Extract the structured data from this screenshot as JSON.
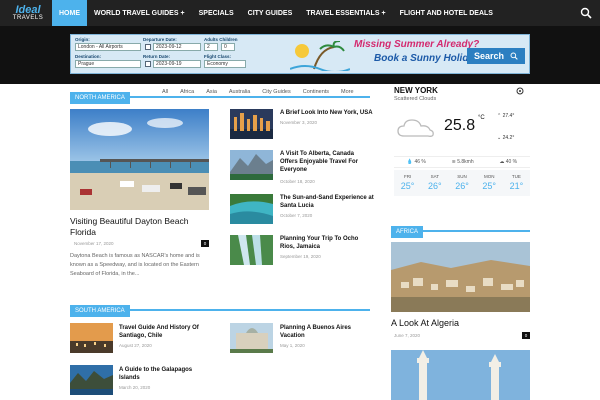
{
  "logo": {
    "line1": "Ideal",
    "line2": "TRAVELS"
  },
  "nav": {
    "items": [
      {
        "label": "HOME",
        "plus": ""
      },
      {
        "label": "WORLD TRAVEL GUIDES",
        "plus": "+"
      },
      {
        "label": "SPECIALS",
        "plus": ""
      },
      {
        "label": "CITY GUIDES",
        "plus": ""
      },
      {
        "label": "TRAVEL ESSENTIALS",
        "plus": "+"
      },
      {
        "label": "FLIGHT AND HOTEL DEALS",
        "plus": ""
      }
    ]
  },
  "booking": {
    "origin_label": "Origin:",
    "origin_value": "London - All Airports",
    "destination_label": "Destination:",
    "destination_value": "Prague",
    "departure_label": "Departure Date:",
    "departure_value": "2023-09-12",
    "return_label": "Return Date:",
    "return_value": "2023-09-19",
    "adults_label": "Adults Children",
    "adults_value": "2",
    "children_value": "0",
    "class_label": "Flight Class:",
    "class_value": "Economy",
    "promo_line1": "Missing Summer Already?",
    "promo_line2": "Book a Sunny Holiday Now!",
    "search_label": "Search"
  },
  "north_america": {
    "tag": "NORTH AMERICA",
    "tabs": [
      "All",
      "Africa",
      "Asia",
      "Australia",
      "City Guides",
      "Continents",
      "More"
    ],
    "featured": {
      "title_line1": "Visiting Beautiful Dayton Beach",
      "title_line2": "Florida",
      "date": "November 17, 2020",
      "comments": "0",
      "excerpt_line1": "Daytona Beach is famous as NASCAR's home and is",
      "excerpt_line2": "known as a Speedway, and is located on the Eastern",
      "excerpt_line3": "Seaboard of Florida, in the..."
    },
    "list": [
      {
        "title1": "A Brief Look Into New York, USA",
        "title2": "",
        "title3": "",
        "date": "November 3, 2020"
      },
      {
        "title1": "A Visit To Alberta, Canada",
        "title2": "Offers Enjoyable Travel For",
        "title3": "Everyone",
        "date": "October 18, 2020"
      },
      {
        "title1": "The Sun-and-Sand Experience at",
        "title2": "Santa Lucia",
        "title3": "",
        "date": "October 7, 2020"
      },
      {
        "title1": "Planning Your Trip To Ocho",
        "title2": "Rios, Jamaica",
        "title3": "",
        "date": "September 19, 2020"
      }
    ]
  },
  "south_america": {
    "tag": "SOUTH AMERICA",
    "items": [
      {
        "title1": "Travel Guide And History Of",
        "title2": "Santiago, Chile",
        "date": "August 27, 2020"
      },
      {
        "title1": "Planning A Buenos Aires",
        "title2": "Vacation",
        "date": "May 1, 2020"
      },
      {
        "title1": "A Guide to the Galapagos",
        "title2": "Islands",
        "date": "March 20, 2020"
      }
    ]
  },
  "weather": {
    "city": "NEW YORK",
    "condition": "Scattered Clouds",
    "temp": "25.8",
    "unit": "°C",
    "high": "27.4",
    "low": "24.2",
    "deg": "°",
    "humidity": "46 %",
    "wind": "5.8kmh",
    "clouds": "40 %",
    "days": [
      {
        "name": "FRI",
        "temp": "25°"
      },
      {
        "name": "SAT",
        "temp": "26°"
      },
      {
        "name": "SUN",
        "temp": "26°"
      },
      {
        "name": "MON",
        "temp": "25°"
      },
      {
        "name": "TUE",
        "temp": "21°"
      }
    ]
  },
  "africa": {
    "tag": "AFRICA",
    "post_title": "A Look At Algeria",
    "post_date": "June 7, 2020",
    "post_comments": "0"
  },
  "colors": {
    "accent": "#4db2ec",
    "nav_bg": "#222222"
  }
}
